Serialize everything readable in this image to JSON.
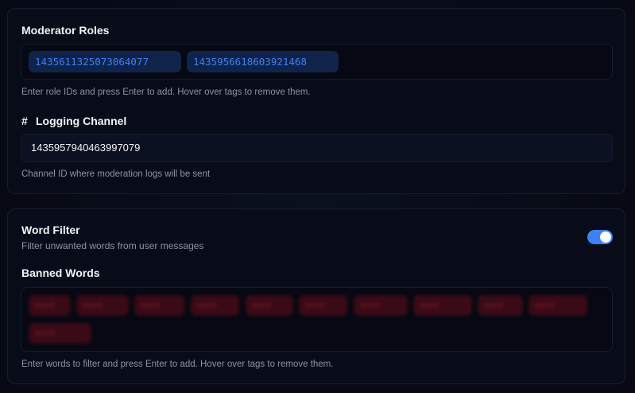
{
  "moderation": {
    "roles_title": "Moderator Roles",
    "roles": [
      "1435611325073064077",
      "1435956618603921468"
    ],
    "roles_help": "Enter role IDs and press Enter to add. Hover over tags to remove them.",
    "logging_title": "Logging Channel",
    "logging_icon": "hash-icon",
    "logging_value": "1435957940463997079",
    "logging_help": "Channel ID where moderation logs will be sent"
  },
  "word_filter": {
    "title": "Word Filter",
    "description": "Filter unwanted words from user messages",
    "enabled": true,
    "banned_title": "Banned Words",
    "banned_words": [
      "word",
      "word",
      "word",
      "word",
      "word",
      "word",
      "word",
      "word",
      "word",
      "word",
      "word"
    ],
    "banned_help": "Enter words to filter and press Enter to add. Hover over tags to remove them."
  },
  "colors": {
    "accent": "#3b82f6",
    "role_tag_bg": "#10234a",
    "banned_tag_bg": "#3a0a16",
    "background": "#070b16"
  }
}
